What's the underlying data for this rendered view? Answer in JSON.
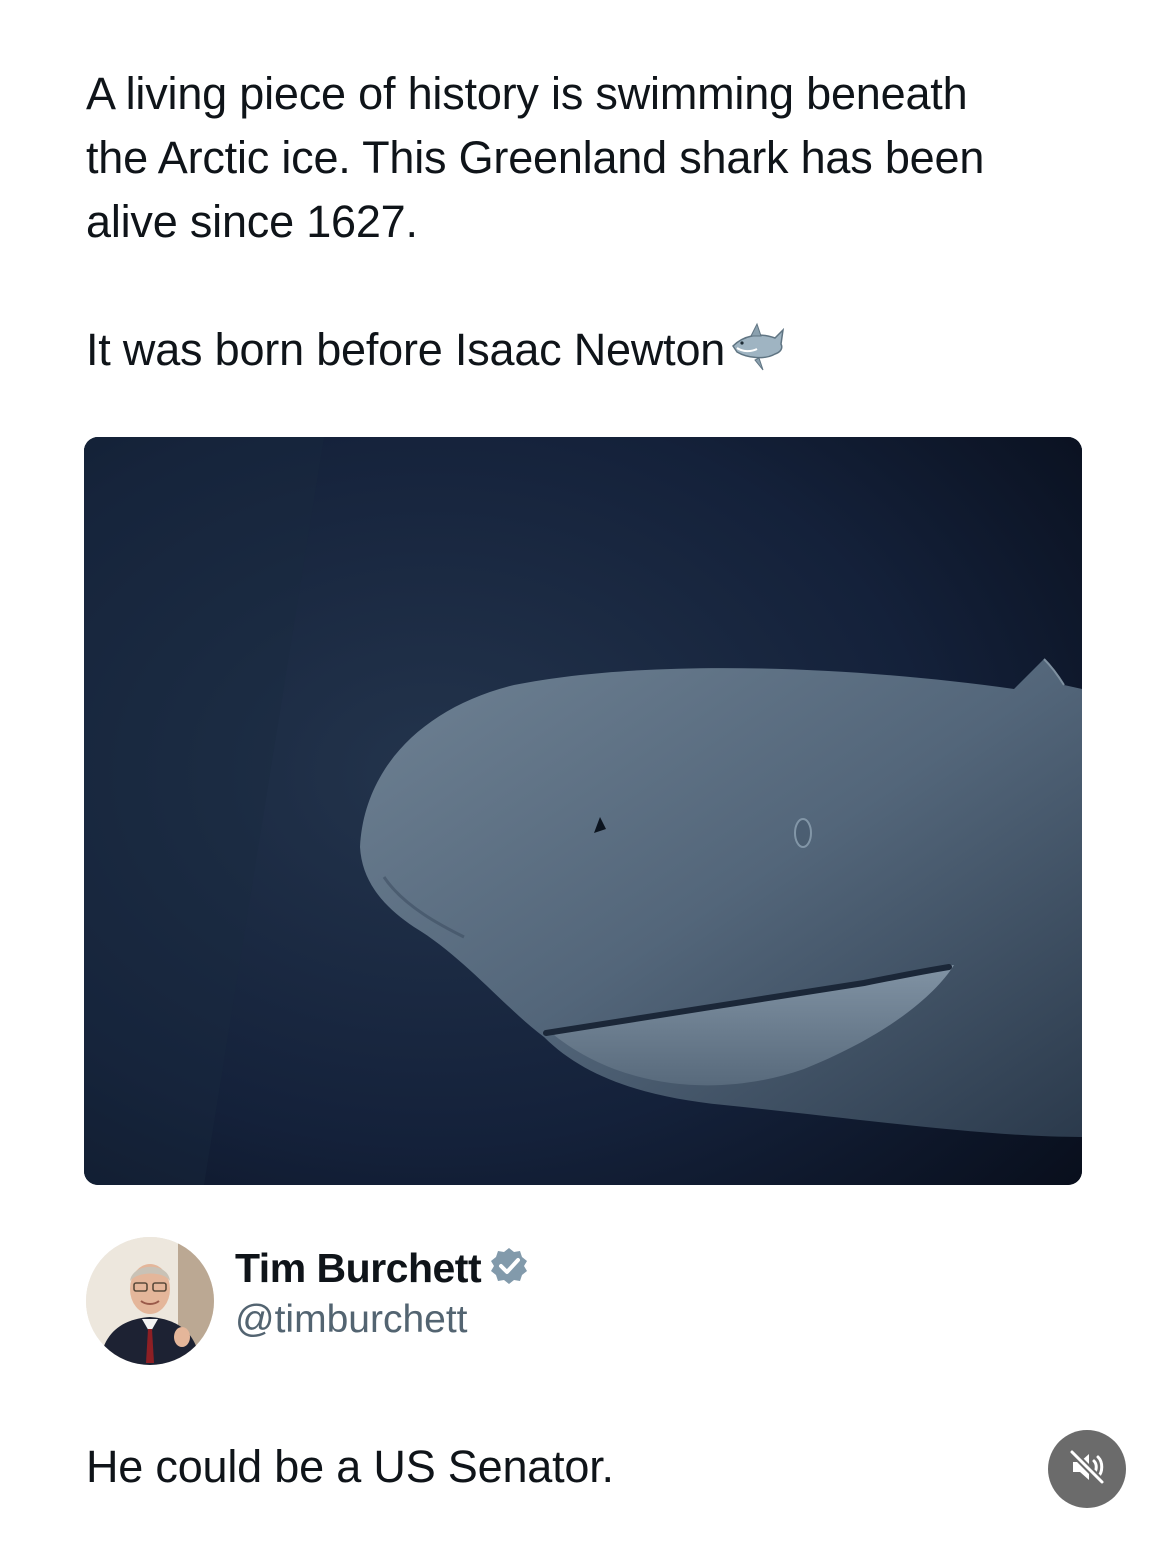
{
  "post": {
    "paragraph1": "A living piece of history is swimming beneath\nthe Arctic ice. This Greenland shark has been\nalive since 1627.",
    "paragraph2": "It was born before Isaac Newton",
    "emoji": "shark-icon"
  },
  "media": {
    "type": "image",
    "subject": "greenland-shark"
  },
  "reply": {
    "author_name": "Tim Burchett",
    "author_handle": "@timburchett",
    "verified": true,
    "verified_color": "#829aab",
    "text": "He could be a US Senator."
  },
  "controls": {
    "mute_icon": "speaker-muted-icon"
  }
}
